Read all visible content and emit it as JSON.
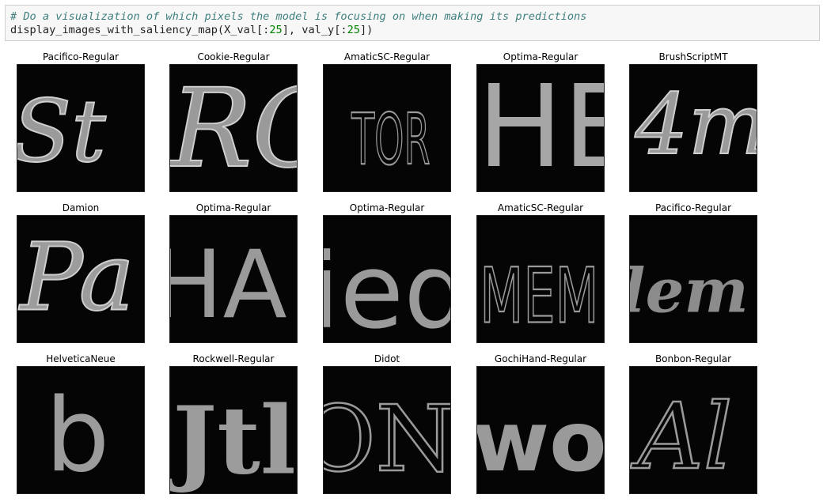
{
  "cell": {
    "comment": "# Do a visualization of which pixels the model is focusing on when making its predictions",
    "code_func": "display_images_with_saliency_map(X_val[:",
    "code_n1": "25",
    "code_mid": "], val_y[:",
    "code_n2": "25",
    "code_end": "])"
  },
  "panels": [
    {
      "title": "Pacifico-Regular",
      "glyph": "St",
      "icon": "saliency-map-St"
    },
    {
      "title": "Cookie-Regular",
      "glyph": "RC",
      "icon": "saliency-map-RC"
    },
    {
      "title": "AmaticSC-Regular",
      "glyph": "TOR",
      "icon": "saliency-map-TOR"
    },
    {
      "title": "Optima-Regular",
      "glyph": "HE",
      "icon": "saliency-map-HE"
    },
    {
      "title": "BrushScriptMT",
      "glyph": "4m",
      "icon": "saliency-map-4m"
    },
    {
      "title": "Damion",
      "glyph": "Pa",
      "icon": "saliency-map-Pa"
    },
    {
      "title": "Optima-Regular",
      "glyph": "HA",
      "icon": "saliency-map-HA"
    },
    {
      "title": "Optima-Regular",
      "glyph": "ied",
      "icon": "saliency-map-ied"
    },
    {
      "title": "AmaticSC-Regular",
      "glyph": "MEM",
      "icon": "saliency-map-MEM"
    },
    {
      "title": "Pacifico-Regular",
      "glyph": "lem",
      "icon": "saliency-map-lem"
    },
    {
      "title": "HelveticaNeue",
      "glyph": "b",
      "icon": "saliency-map-b"
    },
    {
      "title": "Rockwell-Regular",
      "glyph": "Jtl",
      "icon": "saliency-map-Jtl"
    },
    {
      "title": "Didot",
      "glyph": "ONI",
      "icon": "saliency-map-ONI"
    },
    {
      "title": "GochiHand-Regular",
      "glyph": "wo",
      "icon": "saliency-map-wo"
    },
    {
      "title": "Bonbon-Regular",
      "glyph": "Al",
      "icon": "saliency-map-Al"
    }
  ]
}
